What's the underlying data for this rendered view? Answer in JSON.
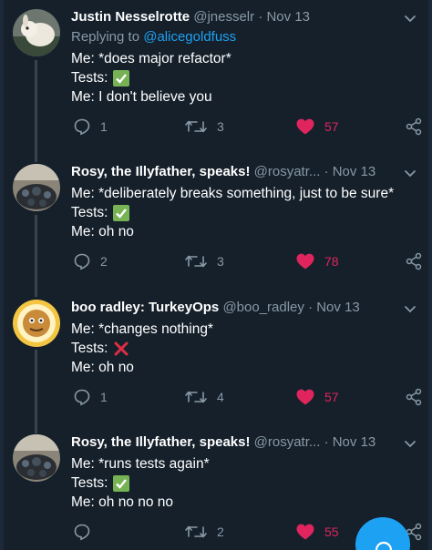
{
  "tweets": [
    {
      "name": "Justin Nesselrotte",
      "handle": "@jnesselr",
      "date": "· Nov 13",
      "replying_prefix": "Replying to",
      "replying_to": "@alicegoldfuss",
      "lines": [
        "Me: *does major refactor*",
        "Tests:",
        "Me: I don't believe you"
      ],
      "tests_badge": "check",
      "replies": "1",
      "retweets": "3",
      "likes": "57"
    },
    {
      "name": "Rosy, the Illyfather, speaks!",
      "handle": "@rosyatr...",
      "date": "· Nov 13",
      "lines": [
        "Me: *deliberately breaks something, just to be sure*",
        "Tests:",
        "Me: oh no"
      ],
      "tests_badge": "check",
      "replies": "2",
      "retweets": "3",
      "likes": "78"
    },
    {
      "name": "boo radley: TurkeyOps",
      "handle": "@boo_radley",
      "date": "· Nov 13",
      "lines": [
        "Me: *changes nothing*",
        "Tests:",
        "Me: oh no"
      ],
      "tests_badge": "cross",
      "replies": "1",
      "retweets": "4",
      "likes": "57"
    },
    {
      "name": "Rosy, the Illyfather, speaks!",
      "handle": "@rosyatr...",
      "date": "· Nov 13",
      "lines": [
        "Me: *runs tests again*",
        "Tests:",
        "Me: oh no no no"
      ],
      "tests_badge": "check",
      "replies": "",
      "retweets": "2",
      "likes": "55"
    }
  ],
  "icons": {
    "reply": "speech-bubble-icon",
    "retweet": "retweet-icon",
    "like": "heart-icon",
    "share": "share-icon",
    "menu": "chevron-down-icon",
    "compose": "compose-icon"
  },
  "colors": {
    "background": "#15202b",
    "text": "#ffffff",
    "muted": "#8899a6",
    "link": "#1da1f2",
    "like": "#e0245e",
    "check": "#77b255",
    "cross": "#dd2e44"
  }
}
